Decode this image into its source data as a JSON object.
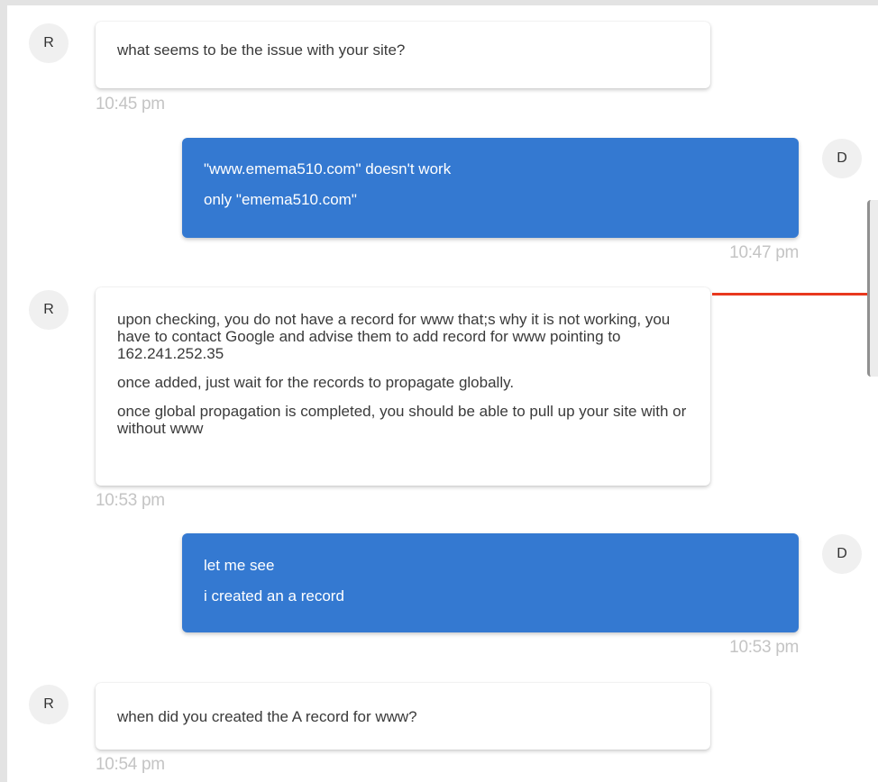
{
  "messages": [
    {
      "sender": "R",
      "side": "agent",
      "lines": [
        "what seems to be the issue with your site?"
      ],
      "time": "10:45 pm"
    },
    {
      "sender": "D",
      "side": "user",
      "lines": [
        "\"www.emema510.com\" doesn't work",
        "only \"emema510.com\""
      ],
      "time": "10:47 pm"
    },
    {
      "sender": "R",
      "side": "agent",
      "lines": [
        "upon  checking, you do not have a record for www that;s why it is not working, you have to contact Google and advise them to add record for www pointing to 162.241.252.35",
        "once added, just wait for the records to propagate globally.",
        "once global propagation is completed, you should be able to pull up your site with or without www"
      ],
      "time": "10:53 pm"
    },
    {
      "sender": "D",
      "side": "user",
      "lines": [
        "let me see",
        "i created an a record"
      ],
      "time": "10:53 pm"
    },
    {
      "sender": "R",
      "side": "agent",
      "lines": [
        "when did you created the A record for www?"
      ],
      "time": "10:54 pm"
    }
  ],
  "colors": {
    "user_bubble": "#3479d1",
    "agent_bubble": "#ffffff",
    "timestamp": "#c4c4c4",
    "marker": "#e8381e"
  }
}
